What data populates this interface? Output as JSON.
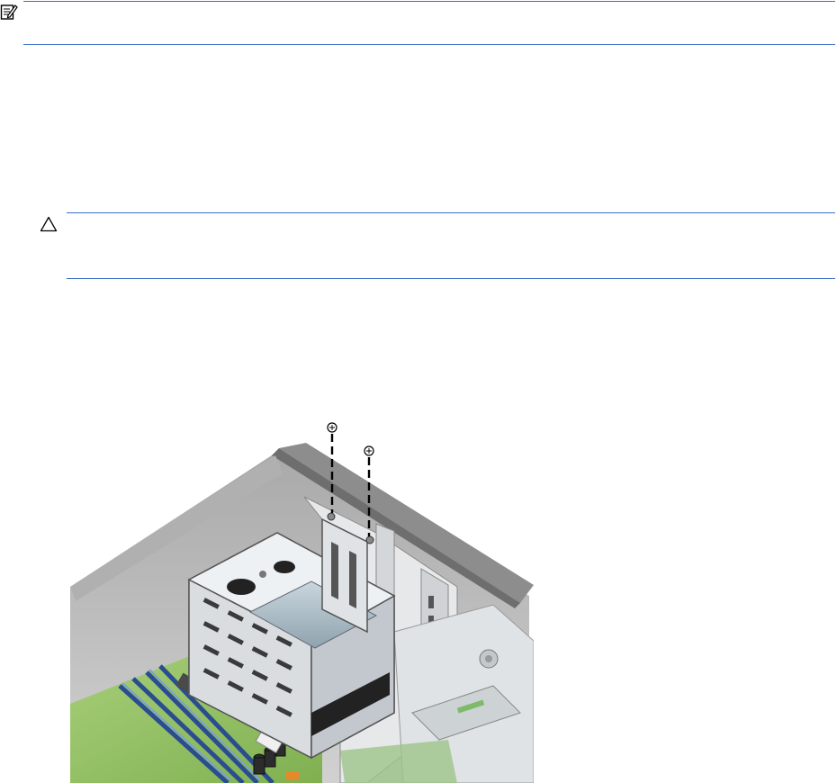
{
  "icons": {
    "note": "note-pencil-icon",
    "caution": "caution-triangle-icon"
  },
  "colors": {
    "rule": "#3b6fc6"
  }
}
